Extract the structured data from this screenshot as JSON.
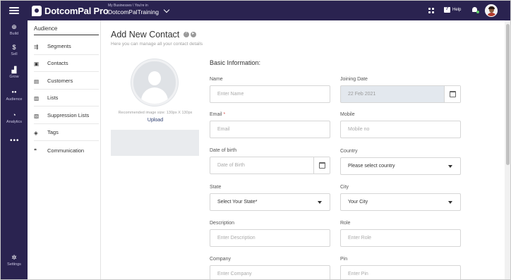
{
  "app": {
    "name": "DotcomPal Pro",
    "business_caption": "My Businesses \\ You're in",
    "business_name": "DotcomPalTraining",
    "help_label": "Help"
  },
  "rail": {
    "items": [
      {
        "label": "Build",
        "icon": "plus-circle-icon",
        "glyph": "⊕"
      },
      {
        "label": "Sell",
        "icon": "dollar-icon",
        "glyph": "$"
      },
      {
        "label": "Grow",
        "icon": "bar-chart-icon",
        "glyph": "▟"
      },
      {
        "label": "Audience",
        "icon": "people-icon",
        "glyph": "●●"
      },
      {
        "label": "Analytics",
        "icon": "analytics-icon",
        "glyph": "◔"
      }
    ],
    "more": "•••",
    "settings": {
      "label": "Settings",
      "icon": "gear-icon",
      "glyph": "✲"
    }
  },
  "subnav": {
    "title": "Audience",
    "items": [
      {
        "label": "Segments",
        "icon": "segments-icon",
        "glyph": "⇶"
      },
      {
        "label": "Contacts",
        "icon": "contacts-icon",
        "glyph": "▣"
      },
      {
        "label": "Customers",
        "icon": "customers-icon",
        "glyph": "▤"
      },
      {
        "label": "Lists",
        "icon": "lists-icon",
        "glyph": "▥"
      },
      {
        "label": "Suppression Lists",
        "icon": "suppression-icon",
        "glyph": "▧"
      },
      {
        "label": "Tags",
        "icon": "tag-icon",
        "glyph": "◈"
      },
      {
        "label": "Communication",
        "icon": "communication-icon",
        "glyph": "❝"
      }
    ]
  },
  "page": {
    "title": "Add New Contact",
    "subtitle": "Here you can manage all your contact details",
    "image_hint": "Recommended image size: 130px X 130px",
    "upload_label": "Upload",
    "section_title": "Basic Information:"
  },
  "form": {
    "name": {
      "label": "Name",
      "placeholder": "Enter Name"
    },
    "joining_date": {
      "label": "Joining Date",
      "value": "22 Feb 2021"
    },
    "email": {
      "label": "Email",
      "required": "*",
      "placeholder": "Email"
    },
    "mobile": {
      "label": "Mobile",
      "placeholder": "Mobile no"
    },
    "dob": {
      "label": "Date of birth",
      "placeholder": "Date of Birth"
    },
    "country": {
      "label": "Country",
      "value": "Please select country"
    },
    "state": {
      "label": "State",
      "value": "Select Your State*"
    },
    "city": {
      "label": "City",
      "value": "Your City"
    },
    "description": {
      "label": "Description",
      "placeholder": "Enter Description"
    },
    "role": {
      "label": "Role",
      "placeholder": "Enter Role"
    },
    "company": {
      "label": "Company",
      "placeholder": "Enter Company"
    },
    "pin": {
      "label": "Pin",
      "placeholder": "Enter Pin"
    }
  },
  "colors": {
    "nav_bg": "#2a2350",
    "accent_link": "#2a3b6e",
    "required": "#d9534f"
  }
}
